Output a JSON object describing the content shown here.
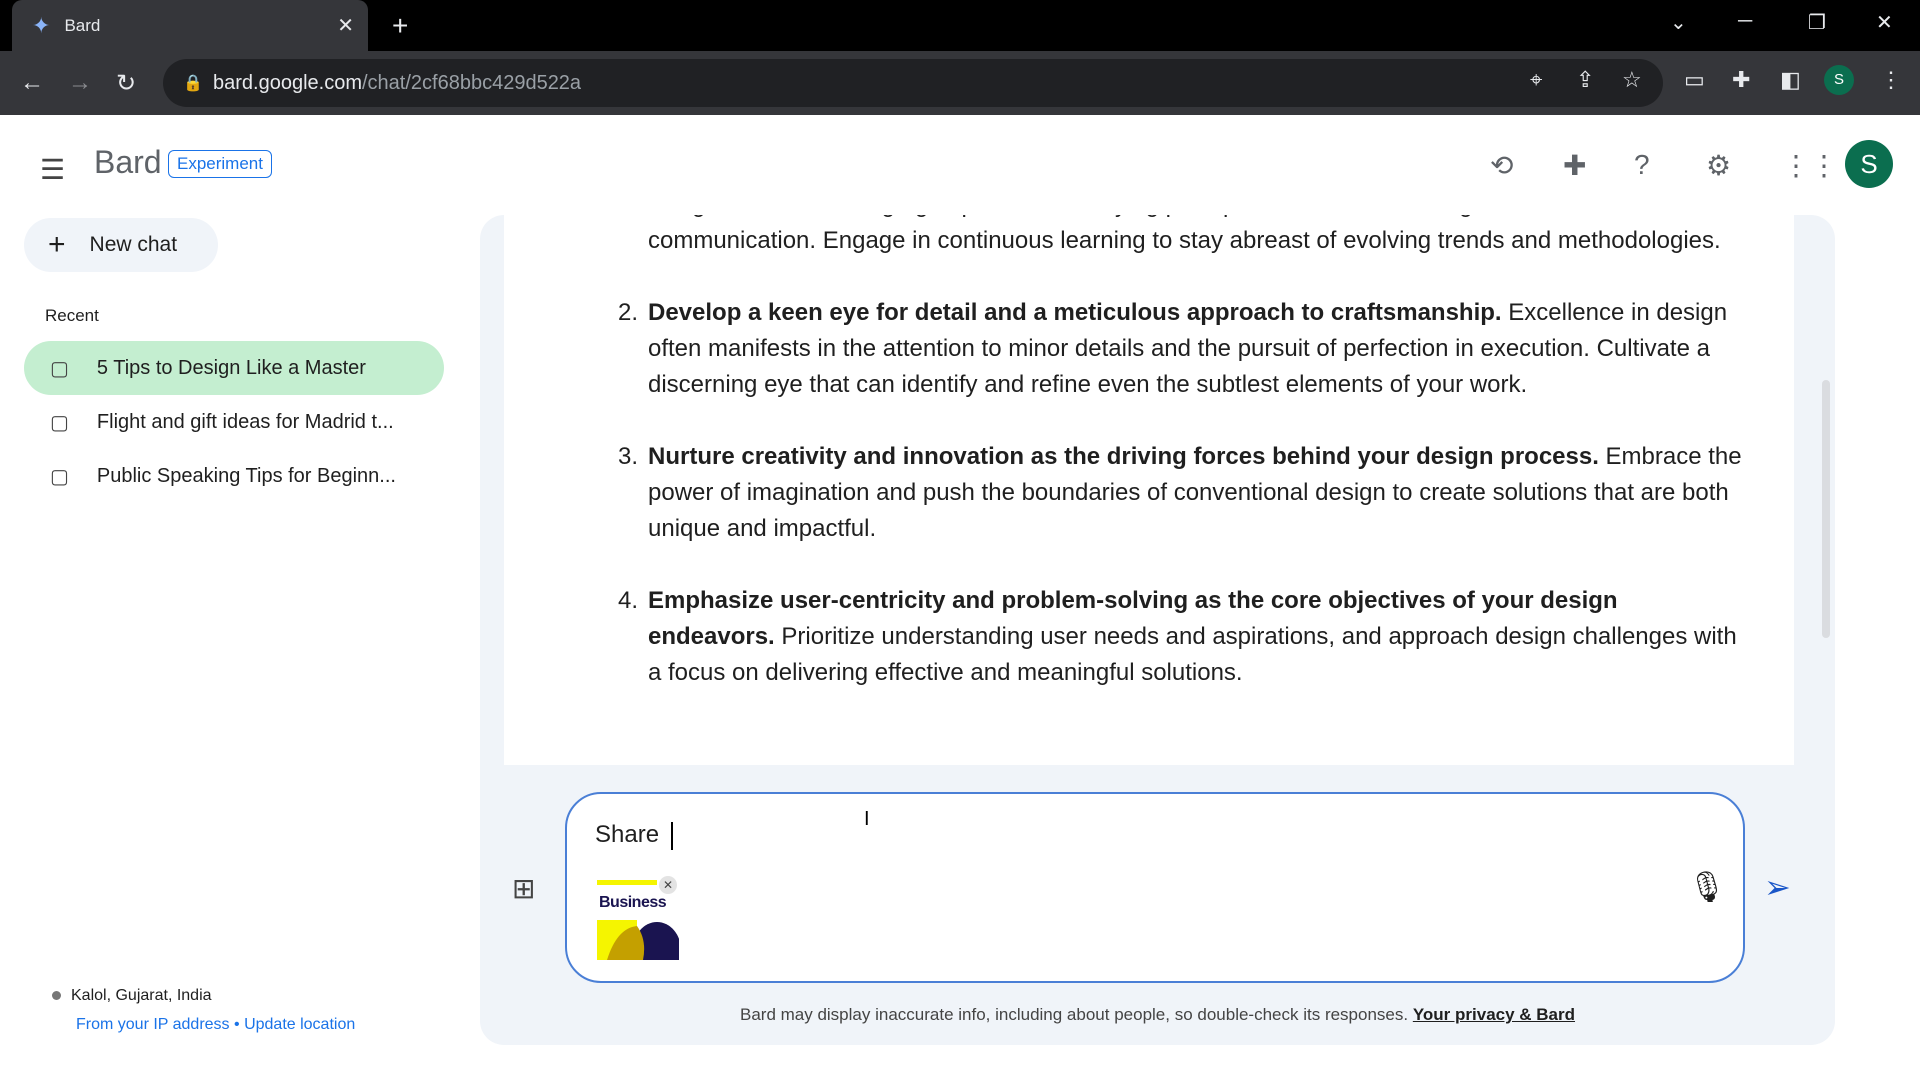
{
  "browser": {
    "tab_title": "Bard",
    "url_host": "bard.google.com",
    "url_path": "/chat/2cf68bbc429d522a",
    "profile_initial": "S"
  },
  "header": {
    "brand": "Bard",
    "badge": "Experiment",
    "avatar_initial": "S"
  },
  "sidebar": {
    "new_chat": "New chat",
    "recent_label": "Recent",
    "items": [
      {
        "label": "5 Tips to Design Like a Master",
        "active": true
      },
      {
        "label": "Flight and gift ideas for Madrid t..."
      },
      {
        "label": "Public Speaking Tips for Beginn..."
      }
    ],
    "location": "Kalol, Gujarat, India",
    "ip_link": "From your IP address",
    "separator": "•",
    "update_link": "Update location"
  },
  "response": {
    "cut_line": "design lies in a thorough grasp of the underlying principles and theories that govern visual",
    "item1_rest": "communication. Engage in continuous learning to stay abreast of evolving trends and methodologies.",
    "items": [
      {
        "num": "2.",
        "bold": "Develop a keen eye for detail and a meticulous approach to craftsmanship.",
        "text": " Excellence in design often manifests in the attention to minor details and the pursuit of perfection in execution. Cultivate a discerning eye that can identify and refine even the subtlest elements of your work."
      },
      {
        "num": "3.",
        "bold": "Nurture creativity and innovation as the driving forces behind your design process.",
        "text": " Embrace the power of imagination and push the boundaries of conventional design to create solutions that are both unique and impactful."
      },
      {
        "num": "4.",
        "bold": "Emphasize user-centricity and problem-solving as the core objectives of your design endeavors.",
        "text": " Prioritize understanding user needs and aspirations, and approach design challenges with a focus on delivering effective and meaningful solutions."
      }
    ]
  },
  "composer": {
    "value": "Share ",
    "attachment_label": "Business"
  },
  "disclaimer": {
    "text": "Bard may display inaccurate info, including about people, so double-check its responses. ",
    "link": "Your privacy & Bard"
  }
}
